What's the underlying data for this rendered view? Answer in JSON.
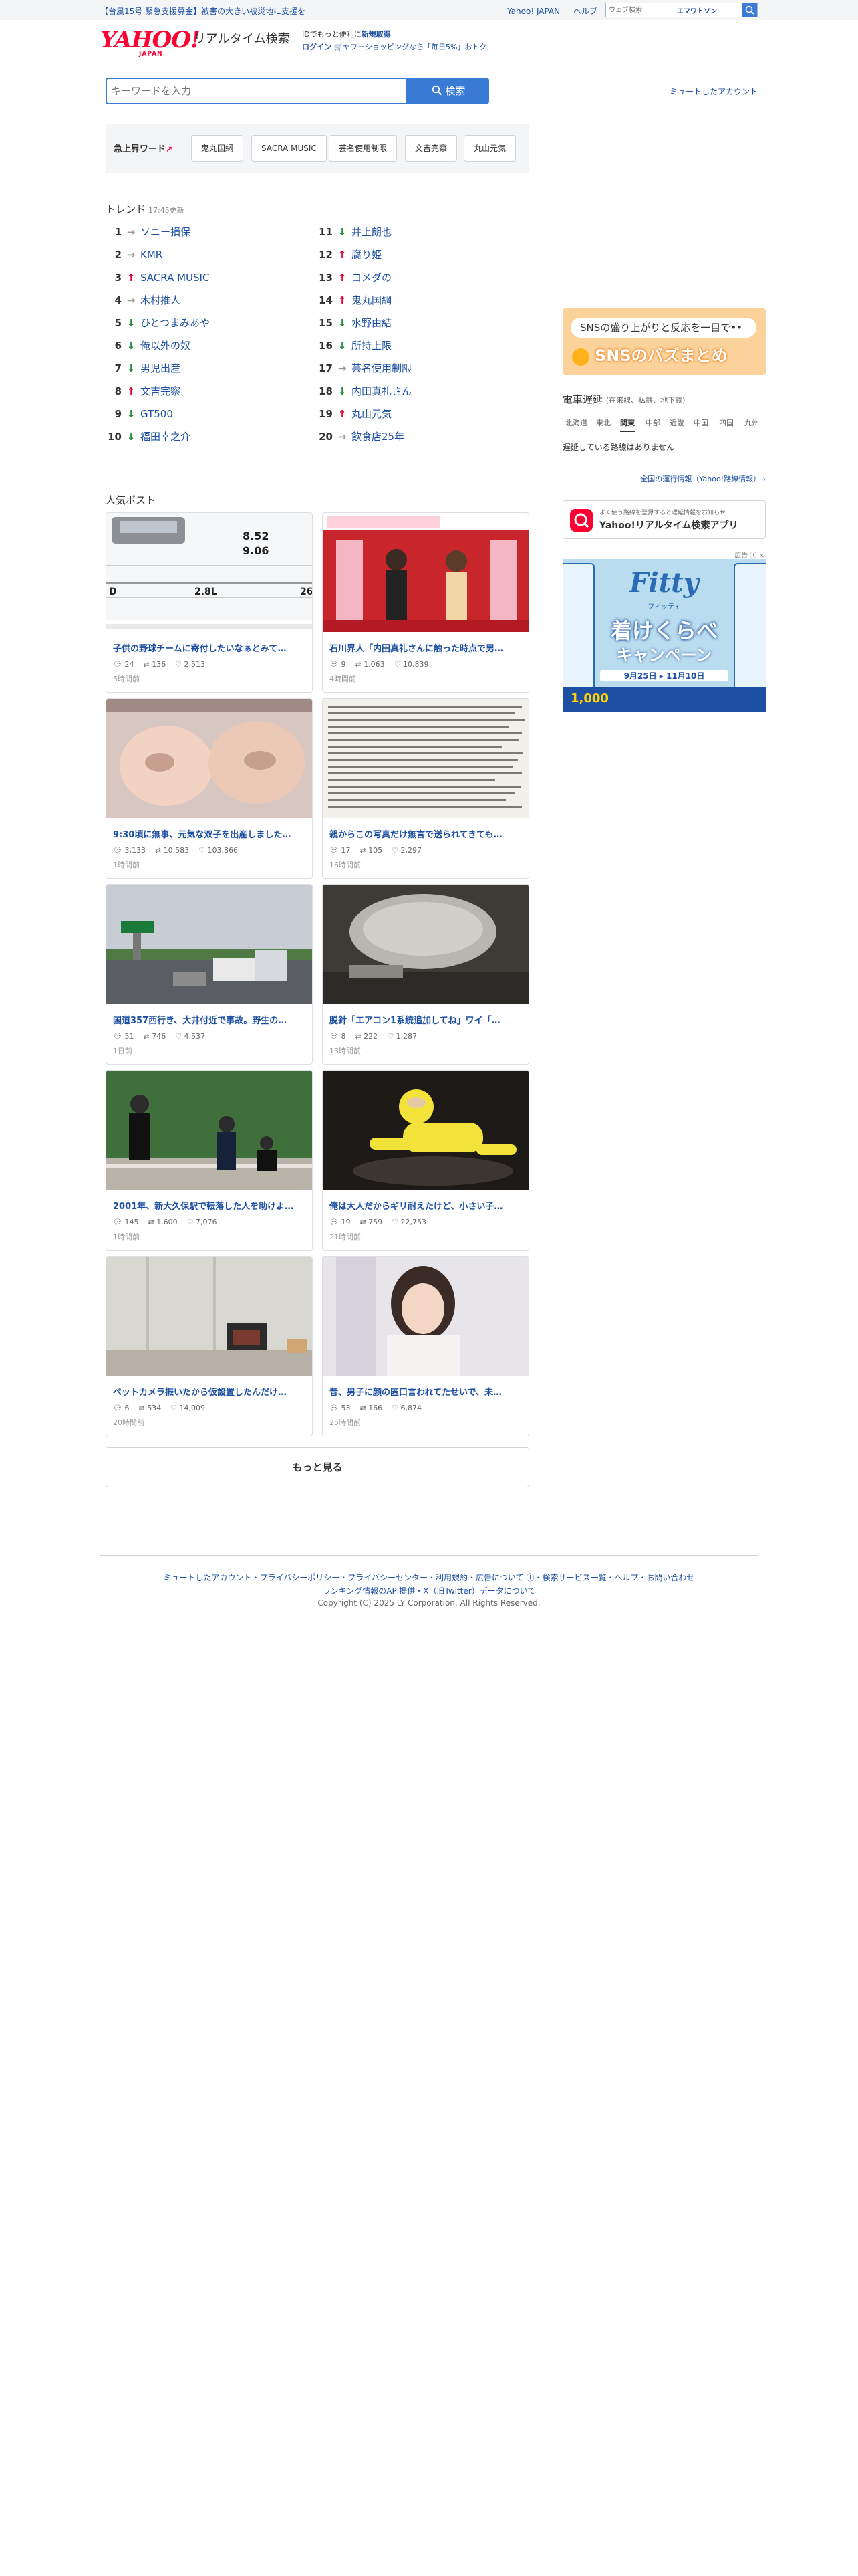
{
  "notice": {
    "text": "【台風15号 緊急支援募金】被害の大きい被災地に支援を",
    "links": [
      "Yahoo! JAPAN",
      "ヘルプ"
    ],
    "web_search_placeholder": "ウェブ検索",
    "emap_label": "エマワトソン"
  },
  "header": {
    "logo": "YAHOO!",
    "logo_sub": "JAPAN",
    "service": "リアルタイム検索",
    "promo_line1_prefix": "IDでもっと便利に",
    "promo_line1_link": "新規取得",
    "promo_line2_login": "ログイン",
    "promo_line2_text": "ヤフーショッピングなら「毎日5%」おトク"
  },
  "search": {
    "placeholder": "キーワードを入力",
    "button_label": "検索",
    "muted_accounts": "ミュートしたアカウント"
  },
  "surge": {
    "label": "急上昇ワード",
    "chips": [
      "鬼丸国綱",
      "SACRA MUSIC",
      "芸名使用制限",
      "文吉完察",
      "丸山元気"
    ]
  },
  "trend": {
    "title": "トレンド",
    "updated": "17:45更新",
    "items": [
      {
        "rank": "1",
        "dir": "same",
        "word": "ソニー損保"
      },
      {
        "rank": "2",
        "dir": "same",
        "word": "KMR"
      },
      {
        "rank": "3",
        "dir": "up",
        "word": "SACRA MUSIC"
      },
      {
        "rank": "4",
        "dir": "same",
        "word": "木村推人"
      },
      {
        "rank": "5",
        "dir": "down",
        "word": "ひとつまみあや"
      },
      {
        "rank": "6",
        "dir": "down",
        "word": "俺以外の奴"
      },
      {
        "rank": "7",
        "dir": "down",
        "word": "男児出産"
      },
      {
        "rank": "8",
        "dir": "up",
        "word": "文吉完察"
      },
      {
        "rank": "9",
        "dir": "down",
        "word": "GT500"
      },
      {
        "rank": "10",
        "dir": "down",
        "word": "福田幸之介"
      },
      {
        "rank": "11",
        "dir": "down",
        "word": "井上朗也"
      },
      {
        "rank": "12",
        "dir": "up",
        "word": "腐り姫"
      },
      {
        "rank": "13",
        "dir": "up",
        "word": "コメダの"
      },
      {
        "rank": "14",
        "dir": "up",
        "word": "鬼丸国綱"
      },
      {
        "rank": "15",
        "dir": "down",
        "word": "水野由結"
      },
      {
        "rank": "16",
        "dir": "down",
        "word": "所持上限"
      },
      {
        "rank": "17",
        "dir": "same",
        "word": "芸名使用制限"
      },
      {
        "rank": "18",
        "dir": "down",
        "word": "内田真礼さん"
      },
      {
        "rank": "19",
        "dir": "up",
        "word": "丸山元気"
      },
      {
        "rank": "20",
        "dir": "same",
        "word": "飲食店25年"
      }
    ]
  },
  "posts": {
    "title": "人気ポスト",
    "more_label": "もっと見る",
    "items": [
      {
        "text": "子供の野球チームに寄付したいなぁとみて…",
        "replies": "24",
        "reposts": "136",
        "likes": "2,513",
        "time": "5時間前",
        "img": "car"
      },
      {
        "text": "石川界人「内田真礼さんに触った時点で男…",
        "replies": "9",
        "reposts": "1,063",
        "likes": "10,839",
        "time": "4時間前",
        "img": "stage"
      },
      {
        "text": "9:30頃に無事、元気な双子を出産しました…",
        "replies": "3,133",
        "reposts": "10,583",
        "likes": "103,866",
        "time": "1時間前",
        "img": "babies"
      },
      {
        "text": "親からこの写真だけ無言で送られてきても…",
        "replies": "17",
        "reposts": "105",
        "likes": "2,297",
        "time": "16時間前",
        "img": "document"
      },
      {
        "text": "国道357西行き、大井付近で事故。野生の…",
        "replies": "51",
        "reposts": "746",
        "likes": "4,537",
        "time": "1日前",
        "img": "road"
      },
      {
        "text": "脱針「エアコン1系統追加してね」ワイ「…",
        "replies": "8",
        "reposts": "222",
        "likes": "1,287",
        "time": "13時間前",
        "img": "duct"
      },
      {
        "text": "2001年、新大久保駅で転落した人を助けよ…",
        "replies": "145",
        "reposts": "1,600",
        "likes": "7,076",
        "time": "1時間前",
        "img": "ceremony"
      },
      {
        "text": "俺は大人だからギリ耐えたけど、小さい子…",
        "replies": "19",
        "reposts": "759",
        "likes": "22,753",
        "time": "21時間前",
        "img": "toy"
      },
      {
        "text": "ペットカメラ振いたから仮設置したんだけ…",
        "replies": "6",
        "reposts": "534",
        "likes": "14,009",
        "time": "20時間前",
        "img": "room"
      },
      {
        "text": "昔、男子に顔の匿口言われてたせいで、未…",
        "replies": "53",
        "reposts": "166",
        "likes": "6,874",
        "time": "25時間前",
        "img": "girl"
      }
    ]
  },
  "side": {
    "sns_bubble": "SNSの盛り上がりと反応を一目で••",
    "sns_title": "SNSのバズまとめ",
    "train_title": "電車遅延",
    "train_sub": "(在来線、私鉄、地下鉄)",
    "regions": [
      "北海道",
      "東北",
      "関東",
      "中部",
      "近畿",
      "中国",
      "四国",
      "九州"
    ],
    "active_region": "関東",
    "no_delay": "遅延している路線はありません",
    "all_train_link": "全国の運行情報（Yahoo!路線情報）",
    "app_sub": "よく使う路線を登録すると遅延情報をお知らせ",
    "app_name": "Yahoo!リアルタイム検索アプリ",
    "ad_tag": "広告",
    "ad_brand": "Fitty",
    "ad_sub": "フィッティ",
    "ad_title": "着けくらべ",
    "ad_campaign": "キャンペーン",
    "ad_date": "9月25日 ▸ 11月10日",
    "ad_amount": "1,000"
  },
  "footer": {
    "links": "ミュートしたアカウント・プライバシーポリシー・プライバシーセンター・利用規約・広告について ⓘ・検索サービス一覧・ヘルプ・お問い合わせ",
    "links2": "ランキング情報のAPI提供・X（旧Twitter）データについて",
    "copyright": "Copyright (C) 2025 LY Corporation. All Rights Reserved."
  },
  "colors": {
    "accent": "#3a7bd5",
    "link": "#1d50a2",
    "up": "#e60033",
    "down": "#1f8a3d",
    "brand": "#ff0033"
  }
}
